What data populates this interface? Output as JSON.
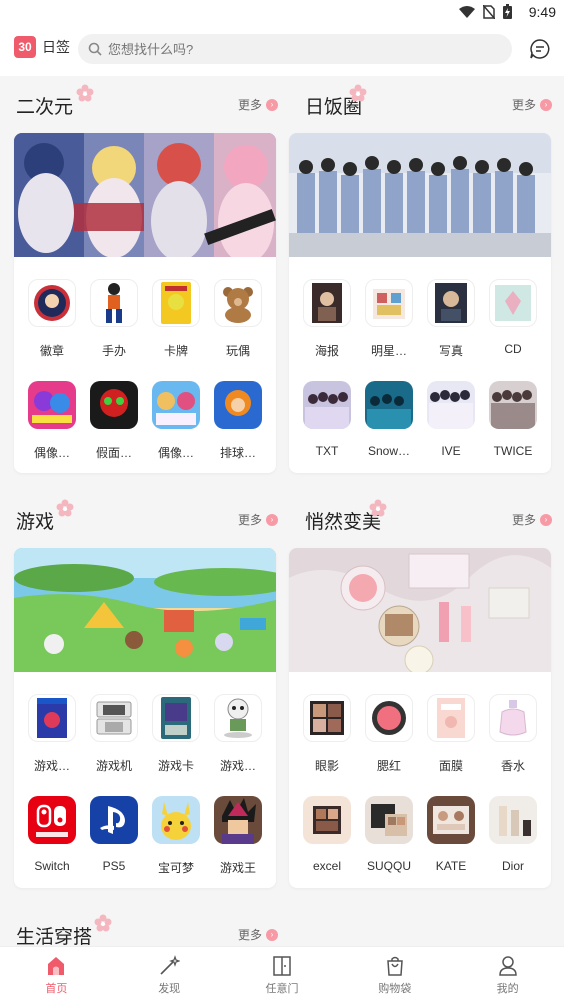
{
  "status": {
    "time": "9:49"
  },
  "header": {
    "signin_day": "30",
    "signin_label": "日签",
    "search_placeholder": "您想找什么吗?"
  },
  "more_label": "更多",
  "sections": [
    {
      "title": "二次元",
      "items": [
        {
          "label": "徽章",
          "icon": "badge-icon"
        },
        {
          "label": "手办",
          "icon": "figure-icon"
        },
        {
          "label": "卡牌",
          "icon": "card-icon"
        },
        {
          "label": "玩偶",
          "icon": "plush-icon"
        },
        {
          "label": "偶像…",
          "icon": "idol-game-icon"
        },
        {
          "label": "假面…",
          "icon": "kamen-rider-icon"
        },
        {
          "label": "偶像…",
          "icon": "idol-anime-icon"
        },
        {
          "label": "排球…",
          "icon": "volleyball-icon"
        }
      ]
    },
    {
      "title": "日饭圈",
      "items": [
        {
          "label": "海报",
          "icon": "poster-icon"
        },
        {
          "label": "明星…",
          "icon": "star-goods-icon"
        },
        {
          "label": "写真",
          "icon": "photobook-icon"
        },
        {
          "label": "CD",
          "icon": "cd-icon"
        },
        {
          "label": "TXT",
          "icon": "txt-group-icon"
        },
        {
          "label": "Snow…",
          "icon": "snow-group-icon"
        },
        {
          "label": "IVE",
          "icon": "ive-group-icon"
        },
        {
          "label": "TWICE",
          "icon": "twice-group-icon"
        }
      ]
    },
    {
      "title": "游戏",
      "items": [
        {
          "label": "游戏…",
          "icon": "game-disc-icon"
        },
        {
          "label": "游戏机",
          "icon": "console-icon"
        },
        {
          "label": "游戏卡",
          "icon": "game-card-icon"
        },
        {
          "label": "游戏…",
          "icon": "amiibo-icon"
        },
        {
          "label": "Switch",
          "icon": "switch-logo-icon"
        },
        {
          "label": "PS5",
          "icon": "ps-logo-icon"
        },
        {
          "label": "宝可梦",
          "icon": "pikachu-icon"
        },
        {
          "label": "游戏王",
          "icon": "yugioh-icon"
        }
      ]
    },
    {
      "title": "悄然变美",
      "items": [
        {
          "label": "眼影",
          "icon": "eyeshadow-icon"
        },
        {
          "label": "腮红",
          "icon": "blush-icon"
        },
        {
          "label": "面膜",
          "icon": "mask-icon"
        },
        {
          "label": "香水",
          "icon": "perfume-icon"
        },
        {
          "label": "excel",
          "icon": "excel-palette-icon"
        },
        {
          "label": "SUQQU",
          "icon": "suqqu-palette-icon"
        },
        {
          "label": "KATE",
          "icon": "kate-palette-icon"
        },
        {
          "label": "Dior",
          "icon": "dior-products-icon"
        }
      ]
    },
    {
      "title": "生活穿搭",
      "items": []
    }
  ],
  "tabs": [
    {
      "label": "首页",
      "icon": "home-icon",
      "active": true
    },
    {
      "label": "发现",
      "icon": "magic-wand-icon",
      "active": false
    },
    {
      "label": "任意门",
      "icon": "door-icon",
      "active": false
    },
    {
      "label": "购物袋",
      "icon": "shopping-bag-icon",
      "active": false
    },
    {
      "label": "我的",
      "icon": "profile-icon",
      "active": false
    }
  ],
  "colors": {
    "accent": "#ef5b6b",
    "more_dot": "#f79aa6",
    "background": "#f5f5f5"
  }
}
